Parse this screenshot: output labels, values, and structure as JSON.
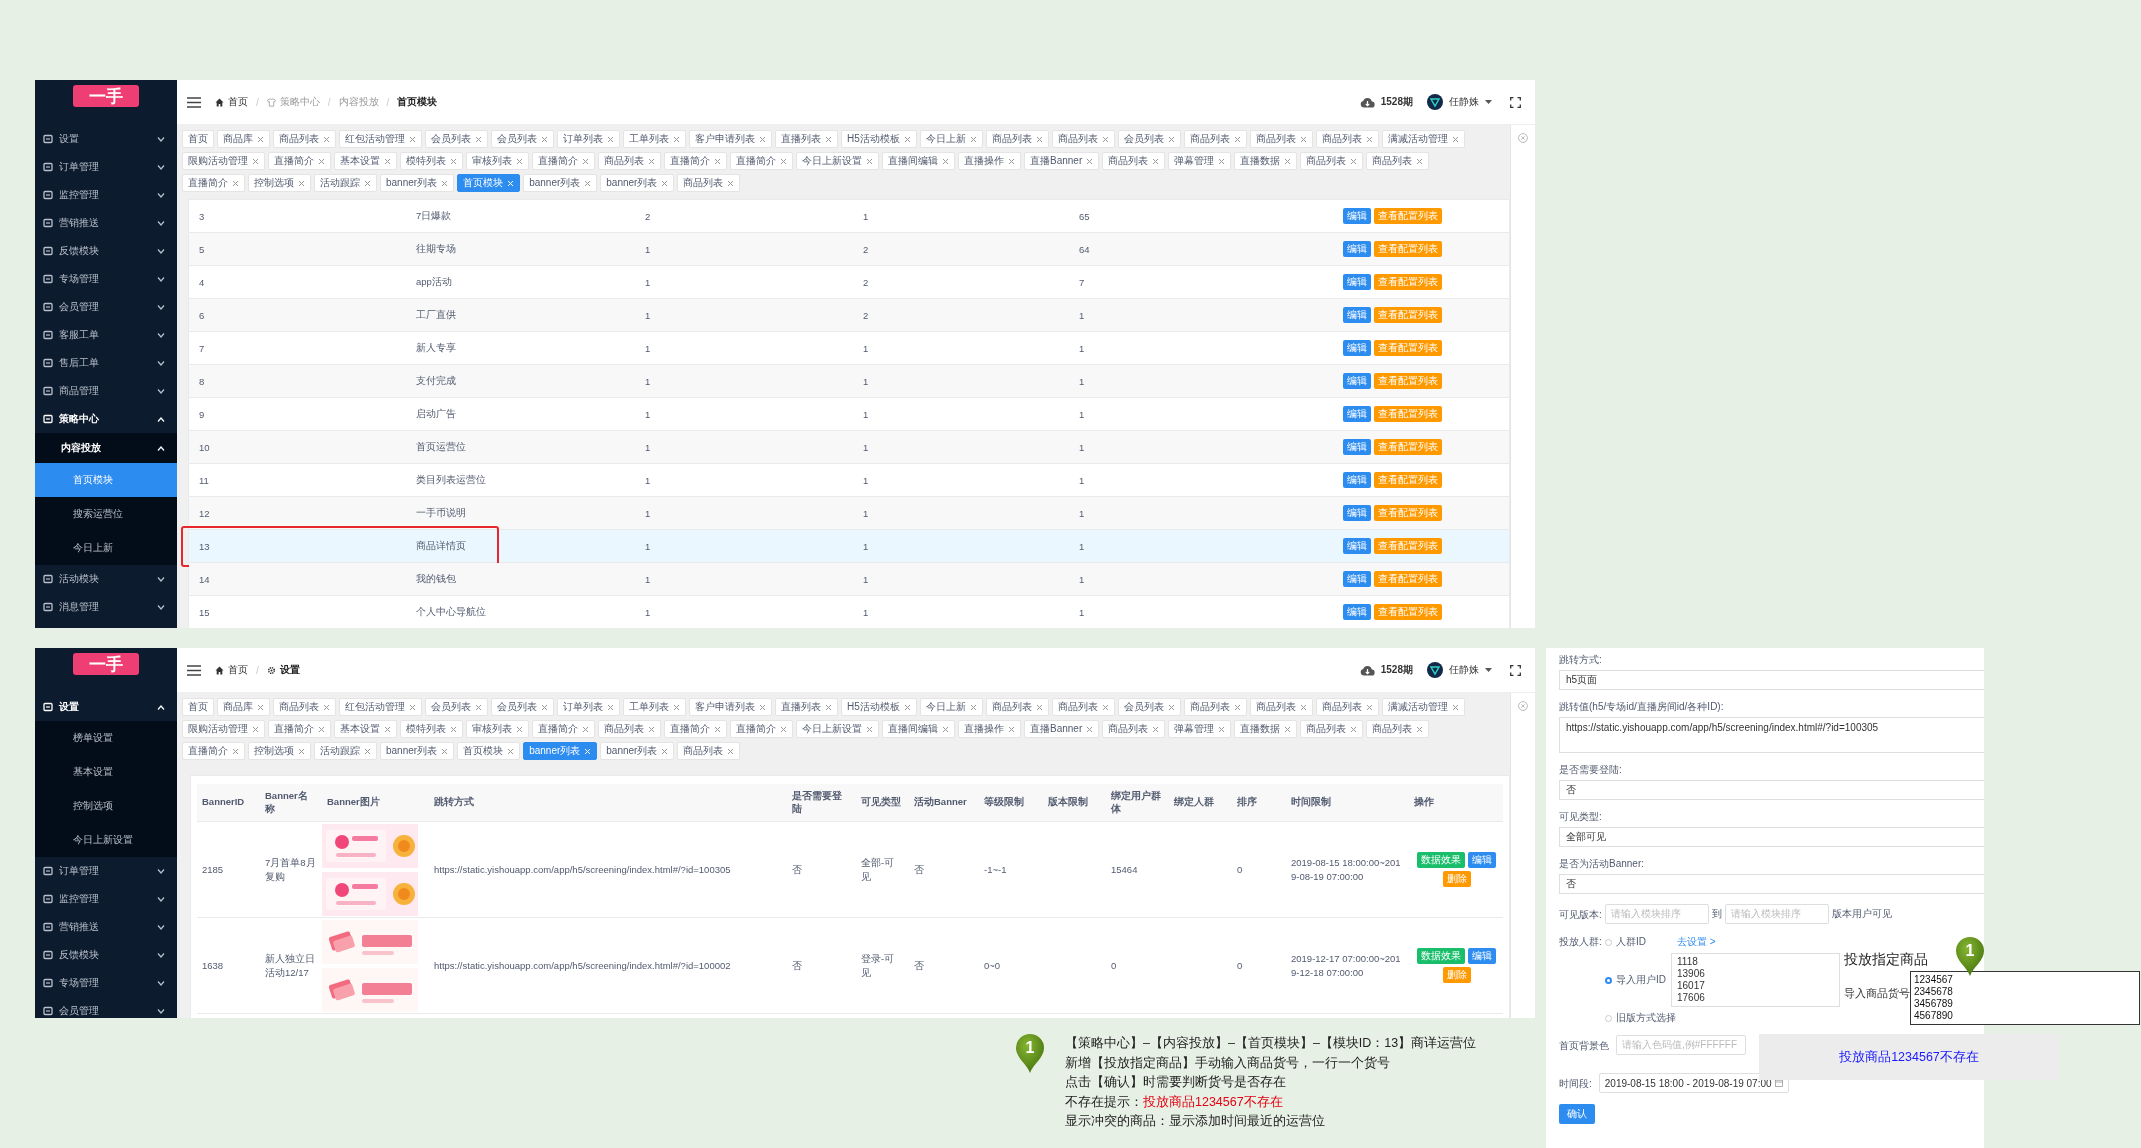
{
  "screens": [
    {
      "logo": "一手",
      "sidebar": [
        {
          "label": "设置",
          "expanded": false
        },
        {
          "label": "订单管理",
          "expanded": false
        },
        {
          "label": "监控管理",
          "expanded": false
        },
        {
          "label": "营销推送",
          "expanded": false
        },
        {
          "label": "反馈模块",
          "expanded": false
        },
        {
          "label": "专场管理",
          "expanded": false
        },
        {
          "label": "会员管理",
          "expanded": false
        },
        {
          "label": "客服工单",
          "expanded": false
        },
        {
          "label": "售后工单",
          "expanded": false
        },
        {
          "label": "商品管理",
          "expanded": false
        },
        {
          "label": "策略中心",
          "expanded": true,
          "children": [
            {
              "label": "内容投放",
              "expanded": true,
              "children": [
                {
                  "label": "首页模块",
                  "selected": true
                },
                {
                  "label": "搜索运营位",
                  "selected": false
                },
                {
                  "label": "今日上新",
                  "selected": false
                }
              ]
            }
          ]
        },
        {
          "label": "活动模块",
          "expanded": false
        },
        {
          "label": "消息管理",
          "expanded": false
        }
      ],
      "breadcrumb": [
        {
          "label": "首页",
          "kind": "home"
        },
        {
          "label": "策略中心",
          "kind": "shirt"
        },
        {
          "label": "内容投放",
          "kind": "plain"
        },
        {
          "label": "首页模块",
          "kind": "plain"
        }
      ],
      "breadcrumb_separator": "/",
      "period": "1528期",
      "user": "任静姝",
      "tab_rows": [
        [
          {
            "label": "首页",
            "closable": false,
            "selected": false
          },
          {
            "label": "商品库",
            "closable": true,
            "selected": false
          },
          {
            "label": "商品列表",
            "closable": true,
            "selected": false
          },
          {
            "label": "红包活动管理",
            "closable": true,
            "selected": false
          },
          {
            "label": "会员列表",
            "closable": true,
            "selected": false
          },
          {
            "label": "会员列表",
            "closable": true,
            "selected": false
          },
          {
            "label": "订单列表",
            "closable": true,
            "selected": false
          },
          {
            "label": "工单列表",
            "closable": true,
            "selected": false
          },
          {
            "label": "客户申请列表",
            "closable": true,
            "selected": false
          },
          {
            "label": "直播列表",
            "closable": true,
            "selected": false
          },
          {
            "label": "H5活动模板",
            "closable": true,
            "selected": false
          },
          {
            "label": "今日上新",
            "closable": true,
            "selected": false
          },
          {
            "label": "商品列表",
            "closable": true,
            "selected": false
          },
          {
            "label": "商品列表",
            "closable": true,
            "selected": false
          },
          {
            "label": "会员列表",
            "closable": true,
            "selected": false
          },
          {
            "label": "商品列表",
            "closable": true,
            "selected": false
          },
          {
            "label": "商品列表",
            "closable": true,
            "selected": false
          },
          {
            "label": "商品列表",
            "closable": true,
            "selected": false
          },
          {
            "label": "满减活动管理",
            "closable": true,
            "selected": false
          }
        ],
        [
          {
            "label": "限购活动管理",
            "closable": true,
            "selected": false
          },
          {
            "label": "直播简介",
            "closable": true,
            "selected": false
          },
          {
            "label": "基本设置",
            "closable": true,
            "selected": false
          },
          {
            "label": "模特列表",
            "closable": true,
            "selected": false
          },
          {
            "label": "审核列表",
            "closable": true,
            "selected": false
          },
          {
            "label": "直播简介",
            "closable": true,
            "selected": false
          },
          {
            "label": "商品列表",
            "closable": true,
            "selected": false
          },
          {
            "label": "直播简介",
            "closable": true,
            "selected": false
          },
          {
            "label": "直播简介",
            "closable": true,
            "selected": false
          },
          {
            "label": "今日上新设置",
            "closable": true,
            "selected": false
          },
          {
            "label": "直播间编辑",
            "closable": true,
            "selected": false
          },
          {
            "label": "直播操作",
            "closable": true,
            "selected": false
          },
          {
            "label": "直播Banner",
            "closable": true,
            "selected": false
          },
          {
            "label": "商品列表",
            "closable": true,
            "selected": false
          },
          {
            "label": "弹幕管理",
            "closable": true,
            "selected": false
          },
          {
            "label": "直播数据",
            "closable": true,
            "selected": false
          },
          {
            "label": "商品列表",
            "closable": true,
            "selected": false
          },
          {
            "label": "商品列表",
            "closable": true,
            "selected": false
          }
        ],
        [
          {
            "label": "直播简介",
            "closable": true,
            "selected": false
          },
          {
            "label": "控制选项",
            "closable": true,
            "selected": false
          },
          {
            "label": "活动跟踪",
            "closable": true,
            "selected": false
          },
          {
            "label": "banner列表",
            "closable": true,
            "selected": false
          },
          {
            "label": "首页模块",
            "closable": true,
            "selected": true
          },
          {
            "label": "banner列表",
            "closable": true,
            "selected": false
          },
          {
            "label": "banner列表",
            "closable": true,
            "selected": false
          },
          {
            "label": "商品列表",
            "closable": true,
            "selected": false
          }
        ]
      ],
      "table": {
        "kind": "modules",
        "rows": [
          {
            "cells": [
              "3",
              "7日爆款",
              "2",
              "1",
              "65"
            ],
            "selected": false,
            "marked": false,
            "actions": [
              "编辑",
              "查看配置列表"
            ]
          },
          {
            "cells": [
              "5",
              "往期专场",
              "1",
              "2",
              "64"
            ],
            "selected": false,
            "marked": false,
            "actions": [
              "编辑",
              "查看配置列表"
            ]
          },
          {
            "cells": [
              "4",
              "app活动",
              "1",
              "2",
              "7"
            ],
            "selected": false,
            "marked": false,
            "actions": [
              "编辑",
              "查看配置列表"
            ]
          },
          {
            "cells": [
              "6",
              "工厂直供",
              "1",
              "2",
              "1"
            ],
            "selected": false,
            "marked": false,
            "actions": [
              "编辑",
              "查看配置列表"
            ]
          },
          {
            "cells": [
              "7",
              "新人专享",
              "1",
              "1",
              "1"
            ],
            "selected": false,
            "marked": false,
            "actions": [
              "编辑",
              "查看配置列表"
            ]
          },
          {
            "cells": [
              "8",
              "支付完成",
              "1",
              "1",
              "1"
            ],
            "selected": false,
            "marked": false,
            "actions": [
              "编辑",
              "查看配置列表"
            ]
          },
          {
            "cells": [
              "9",
              "启动广告",
              "1",
              "1",
              "1"
            ],
            "selected": false,
            "marked": false,
            "actions": [
              "编辑",
              "查看配置列表"
            ]
          },
          {
            "cells": [
              "10",
              "首页运营位",
              "1",
              "1",
              "1"
            ],
            "selected": false,
            "marked": false,
            "actions": [
              "编辑",
              "查看配置列表"
            ]
          },
          {
            "cells": [
              "11",
              "类目列表运营位",
              "1",
              "1",
              "1"
            ],
            "selected": false,
            "marked": false,
            "actions": [
              "编辑",
              "查看配置列表"
            ]
          },
          {
            "cells": [
              "12",
              "一手币说明",
              "1",
              "1",
              "1"
            ],
            "selected": false,
            "marked": false,
            "actions": [
              "编辑",
              "查看配置列表"
            ]
          },
          {
            "cells": [
              "13",
              "商品详情页",
              "1",
              "1",
              "1"
            ],
            "selected": true,
            "marked": true,
            "actions": [
              "编辑",
              "查看配置列表"
            ]
          },
          {
            "cells": [
              "14",
              "我的钱包",
              "1",
              "1",
              "1"
            ],
            "selected": false,
            "marked": false,
            "actions": [
              "编辑",
              "查看配置列表"
            ]
          },
          {
            "cells": [
              "15",
              "个人中心导航位",
              "1",
              "1",
              "1"
            ],
            "selected": false,
            "marked": false,
            "actions": [
              "编辑",
              "查看配置列表"
            ]
          }
        ]
      }
    },
    {
      "logo": "一手",
      "sidebar": [
        {
          "label": "设置",
          "expanded": true,
          "children": [
            {
              "label": "榜单设置",
              "selected": false
            },
            {
              "label": "基本设置",
              "selected": false
            },
            {
              "label": "控制选项",
              "selected": false
            },
            {
              "label": "今日上新设置",
              "selected": false
            }
          ]
        },
        {
          "label": "订单管理",
          "expanded": false
        },
        {
          "label": "监控管理",
          "expanded": false
        },
        {
          "label": "营销推送",
          "expanded": false
        },
        {
          "label": "反馈模块",
          "expanded": false
        },
        {
          "label": "专场管理",
          "expanded": false
        },
        {
          "label": "会员管理",
          "expanded": false
        }
      ],
      "breadcrumb": [
        {
          "label": "首页",
          "kind": "home"
        },
        {
          "label": "设置",
          "kind": "gear"
        }
      ],
      "breadcrumb_separator": "/",
      "period": "1528期",
      "user": "任静姝",
      "tab_rows": [
        [
          {
            "label": "首页",
            "closable": false,
            "selected": false
          },
          {
            "label": "商品库",
            "closable": true,
            "selected": false
          },
          {
            "label": "商品列表",
            "closable": true,
            "selected": false
          },
          {
            "label": "红包活动管理",
            "closable": true,
            "selected": false
          },
          {
            "label": "会员列表",
            "closable": true,
            "selected": false
          },
          {
            "label": "会员列表",
            "closable": true,
            "selected": false
          },
          {
            "label": "订单列表",
            "closable": true,
            "selected": false
          },
          {
            "label": "工单列表",
            "closable": true,
            "selected": false
          },
          {
            "label": "客户申请列表",
            "closable": true,
            "selected": false
          },
          {
            "label": "直播列表",
            "closable": true,
            "selected": false
          },
          {
            "label": "H5活动模板",
            "closable": true,
            "selected": false
          },
          {
            "label": "今日上新",
            "closable": true,
            "selected": false
          },
          {
            "label": "商品列表",
            "closable": true,
            "selected": false
          },
          {
            "label": "商品列表",
            "closable": true,
            "selected": false
          },
          {
            "label": "会员列表",
            "closable": true,
            "selected": false
          },
          {
            "label": "商品列表",
            "closable": true,
            "selected": false
          },
          {
            "label": "商品列表",
            "closable": true,
            "selected": false
          },
          {
            "label": "商品列表",
            "closable": true,
            "selected": false
          },
          {
            "label": "满减活动管理",
            "closable": true,
            "selected": false
          }
        ],
        [
          {
            "label": "限购活动管理",
            "closable": true,
            "selected": false
          },
          {
            "label": "直播简介",
            "closable": true,
            "selected": false
          },
          {
            "label": "基本设置",
            "closable": true,
            "selected": false
          },
          {
            "label": "模特列表",
            "closable": true,
            "selected": false
          },
          {
            "label": "审核列表",
            "closable": true,
            "selected": false
          },
          {
            "label": "直播简介",
            "closable": true,
            "selected": false
          },
          {
            "label": "商品列表",
            "closable": true,
            "selected": false
          },
          {
            "label": "直播简介",
            "closable": true,
            "selected": false
          },
          {
            "label": "直播简介",
            "closable": true,
            "selected": false
          },
          {
            "label": "今日上新设置",
            "closable": true,
            "selected": false
          },
          {
            "label": "直播间编辑",
            "closable": true,
            "selected": false
          },
          {
            "label": "直播操作",
            "closable": true,
            "selected": false
          },
          {
            "label": "直播Banner",
            "closable": true,
            "selected": false
          },
          {
            "label": "商品列表",
            "closable": true,
            "selected": false
          },
          {
            "label": "弹幕管理",
            "closable": true,
            "selected": false
          },
          {
            "label": "直播数据",
            "closable": true,
            "selected": false
          },
          {
            "label": "商品列表",
            "closable": true,
            "selected": false
          },
          {
            "label": "商品列表",
            "closable": true,
            "selected": false
          }
        ],
        [
          {
            "label": "直播简介",
            "closable": true,
            "selected": false
          },
          {
            "label": "控制选项",
            "closable": true,
            "selected": false
          },
          {
            "label": "活动跟踪",
            "closable": true,
            "selected": false
          },
          {
            "label": "banner列表",
            "closable": true,
            "selected": false
          },
          {
            "label": "首页模块",
            "closable": true,
            "selected": false
          },
          {
            "label": "banner列表",
            "closable": true,
            "selected": true
          },
          {
            "label": "banner列表",
            "closable": true,
            "selected": false
          },
          {
            "label": "商品列表",
            "closable": true,
            "selected": false
          }
        ]
      ],
      "table": {
        "kind": "banners",
        "columns": [
          "BannerID",
          "Banner名称",
          "Banner图片",
          "跳转方式",
          "是否需要登陆",
          "可见类型",
          "活动Banner",
          "等级限制",
          "版本限制",
          "绑定用户群体",
          "绑定人群",
          "排序",
          "时间限制",
          "操作"
        ],
        "rows": [
          {
            "banner_id": "2185",
            "name": "7月首单8月复购",
            "images": [
              {
                "kind": "picture"
              },
              {
                "kind": "picture"
              }
            ],
            "link": "https://static.yishouapp.com/app/h5/screening/index.html#/?id=100305",
            "login_required": "否",
            "visibility": "全部-可见",
            "activity_banner": "否",
            "level_limit": "-1~-1",
            "user_group": "15464",
            "sort": "0",
            "time": "2019-08-15 18:00:00~2019-08-19 07:00:00",
            "actions": [
              "数据效果",
              "编辑",
              "删除"
            ]
          },
          {
            "banner_id": "1638",
            "name": "新人独立日活动12/17",
            "images": [
              {
                "kind": "picture"
              },
              {
                "kind": "picture"
              }
            ],
            "link": "https://static.yishouapp.com/app/h5/screening/index.html#/?id=100002",
            "login_required": "否",
            "visibility": "登录-可见",
            "activity_banner": "否",
            "level_limit": "0~0",
            "user_group": "0",
            "sort": "0",
            "time": "2019-12-17 07:00:00~2019-12-18 07:00:00",
            "actions": [
              "数据效果",
              "编辑",
              "删除"
            ]
          }
        ]
      }
    }
  ],
  "form": {
    "fields": [
      {
        "kind": "select",
        "label": "跳转方式:",
        "value": "h5页面"
      },
      {
        "kind": "textarea",
        "label": "跳转值(h5/专场id/直播房间id/各种ID):",
        "value": "https://static.yishouapp.com/app/h5/screening/index.html#/?id=100305"
      },
      {
        "kind": "select",
        "label": "是否需要登陆:",
        "value": "否"
      },
      {
        "kind": "select",
        "label": "可见类型:",
        "value": "全部可见"
      },
      {
        "kind": "select",
        "label": "是否为活动Banner:",
        "value": "否"
      },
      {
        "kind": "range",
        "label": "可见版本:",
        "placeholder_from": "请输入模块排序",
        "joiner": "到",
        "placeholder_to": "请输入模块排序",
        "suffix": "版本用户可见"
      },
      {
        "kind": "audience",
        "label": "投放人群:",
        "options": [
          {
            "label": "人群ID",
            "selected": false,
            "link": "去设置 >"
          },
          {
            "label": "导入用户ID",
            "selected": true,
            "value": "1118\n13906\n16017\n17606"
          },
          {
            "label": "旧版方式选择",
            "selected": false
          }
        ]
      },
      {
        "kind": "input",
        "label": "首页背景色",
        "placeholder": "请输入色码值,例#FFFFFF"
      },
      {
        "kind": "date",
        "label": "时间段:",
        "value": "2019-08-15 18:00 - 2019-08-19 07:00"
      }
    ],
    "submit": "确认"
  },
  "callout": {
    "title": "投放指定商品",
    "field_label": "导入商品货号",
    "value": "1234567\n2345678\n3456789\n4567890",
    "pin": "1",
    "message": "投放商品1234567不存在"
  },
  "note": {
    "pin": "1",
    "lines": [
      {
        "text": "【策略中心】–【内容投放】–【首页模块】–【模块ID：13】商详运营位"
      },
      {
        "text": "新增【投放指定商品】手动输入商品货号，一行一个货号"
      },
      {
        "text": "点击【确认】时需要判断货号是否存在"
      },
      {
        "text": "不存在提示：",
        "highlight": "投放商品1234567不存在"
      },
      {
        "text": "显示冲突的商品：显示添加时间最近的运营位"
      }
    ]
  }
}
